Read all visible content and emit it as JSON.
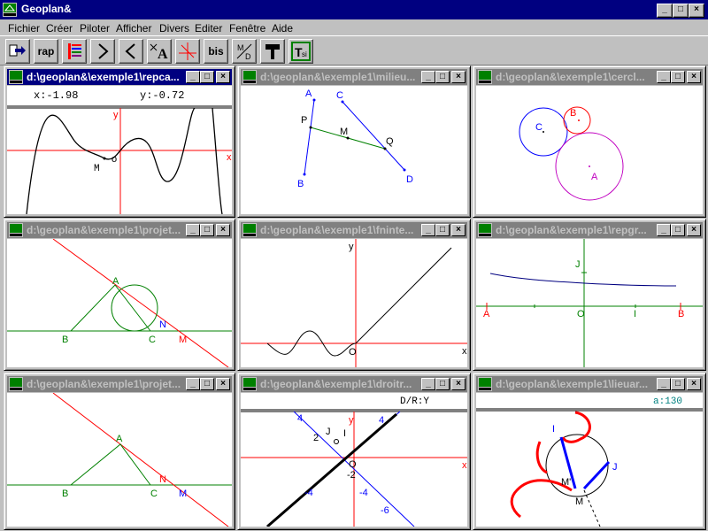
{
  "app": {
    "title": "Geoplan&"
  },
  "menu": [
    "Fichier",
    "Créer",
    "Piloter",
    "Afficher",
    "Divers",
    "Editer",
    "Fenêtre",
    "Aide"
  ],
  "toolbar": {
    "rap": "rap",
    "bis": "bis",
    "md": "M/D"
  },
  "windows": [
    {
      "title": "d:\\geoplan&\\exemple1\\repca..."
    },
    {
      "title": "d:\\geoplan&\\exemple1\\milieu..."
    },
    {
      "title": "d:\\geoplan&\\exemple1\\cercl..."
    },
    {
      "title": "d:\\geoplan&\\exemple1\\projet..."
    },
    {
      "title": "d:\\geoplan&\\exemple1\\fninte..."
    },
    {
      "title": "d:\\geoplan&\\exemple1\\repgr..."
    },
    {
      "title": "d:\\geoplan&\\exemple1\\projet..."
    },
    {
      "title": "d:\\geoplan&\\exemple1\\droitr..."
    },
    {
      "title": "d:\\geoplan&\\exemple1\\lieuar..."
    }
  ],
  "w1": {
    "x": "x:-1.98",
    "y": "y:-0.72",
    "lx": "x",
    "ly": "y",
    "o": "o",
    "m": "M"
  },
  "w2": {
    "a": "A",
    "b": "B",
    "c": "C",
    "d": "D",
    "p": "P",
    "m": "M",
    "q": "Q"
  },
  "w3": {
    "a": "A",
    "b": "B",
    "c": "C"
  },
  "w4": {
    "a": "A",
    "b": "B",
    "c": "C",
    "n": "N",
    "m": "M"
  },
  "w5": {
    "lx": "x",
    "ly": "y",
    "o": "O"
  },
  "w6": {
    "a": "A",
    "b": "B",
    "i": "I",
    "j": "J",
    "o": "O"
  },
  "w7": {
    "a": "A",
    "b": "B",
    "c": "C",
    "n": "N",
    "m": "M"
  },
  "w8": {
    "status": "D/R:Y",
    "lx": "x",
    "ly": "y",
    "o": "O",
    "n4": "4",
    "n2": "2",
    "nm2": "-2",
    "nm4": "-4",
    "nm4b": "-4",
    "nm6": "-6",
    "n4b": "4",
    "i": "I",
    "j": "J"
  },
  "w9": {
    "status": "a:130",
    "i": "I",
    "j": "J",
    "m": "M",
    "m2": "M'"
  }
}
